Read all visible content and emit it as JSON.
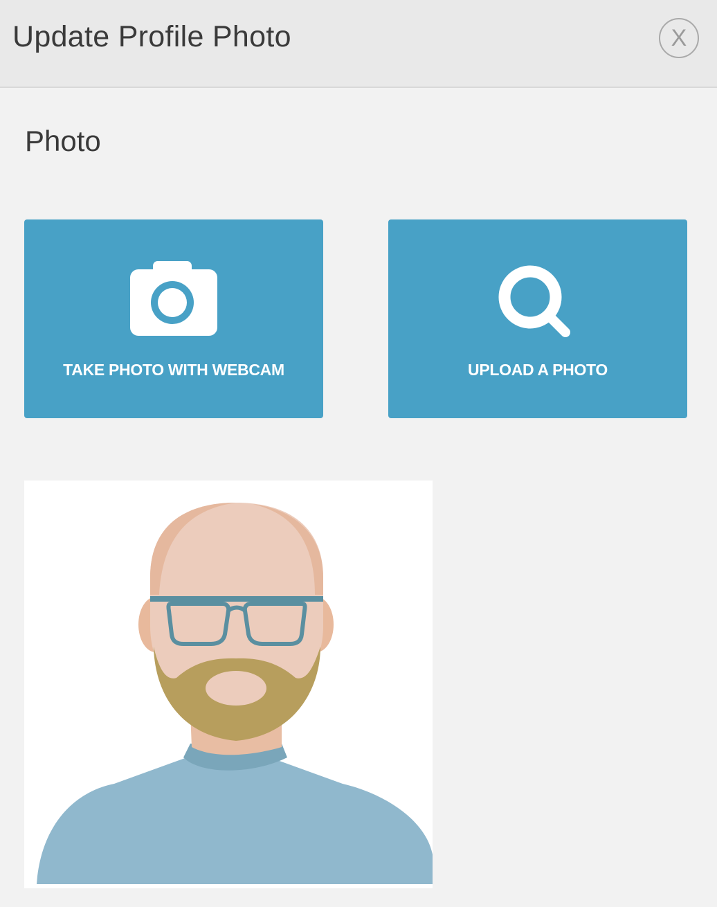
{
  "dialog": {
    "title": "Update Profile Photo",
    "close_label": "X"
  },
  "photo_section": {
    "label": "Photo",
    "actions": [
      {
        "label": "TAKE PHOTO WITH WEBCAM",
        "icon": "camera-icon"
      },
      {
        "label": "UPLOAD A PHOTO",
        "icon": "search-icon"
      }
    ],
    "preview": {
      "icon": "avatar-placeholder"
    }
  },
  "colors": {
    "header_bg": "#e9e9e9",
    "page_bg": "#f2f2f2",
    "button_bg": "#48a1c6",
    "button_text": "#ffffff"
  }
}
